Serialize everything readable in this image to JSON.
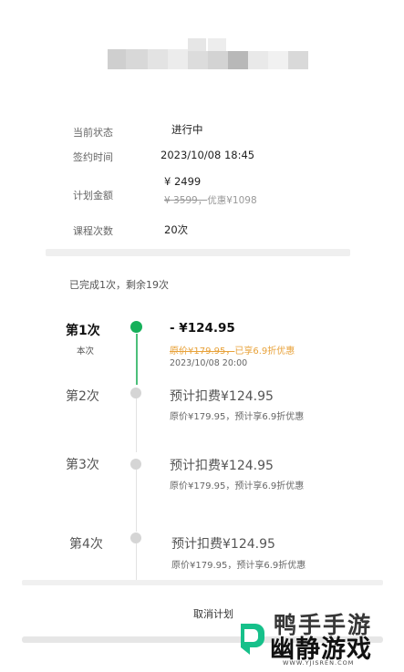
{
  "info": {
    "status_label": "当前状态",
    "status_value": "进行中",
    "sign_label": "签约时间",
    "sign_value": "2023/10/08  18:45",
    "amount_label": "计划金额",
    "amount_value": "¥ 2499",
    "amount_original": "¥ 3599，",
    "amount_discount": "优惠¥1098",
    "count_label": "课程次数",
    "count_value": "20次"
  },
  "summary": "已完成1次，剩余19次",
  "steps": [
    {
      "label": "第1次",
      "sub": "本次",
      "amount": "- ¥124.95",
      "orig_strike": "原价¥179.95，",
      "orig_rest": "已享6.9折优惠",
      "date": "2023/10/08  20:00"
    },
    {
      "label": "第2次",
      "amount": "预计扣费¥124.95",
      "orig": "原价¥179.95，预计享6.9折优惠"
    },
    {
      "label": "第3次",
      "amount": "预计扣费¥124.95",
      "orig": "原价¥179.95，预计享6.9折优惠"
    },
    {
      "label": "第4次",
      "amount": "预计扣费¥124.95",
      "orig": "原价¥179.95，预计享6.9折优惠"
    }
  ],
  "cancel_label": "取消计划",
  "watermark": {
    "top_text": "鸭手手游",
    "main_text": "幽静游戏",
    "url": "WWW.YJISREN.COM"
  },
  "colors": {
    "active_green": "#16b05a",
    "discount_orange": "#e8a23a"
  }
}
